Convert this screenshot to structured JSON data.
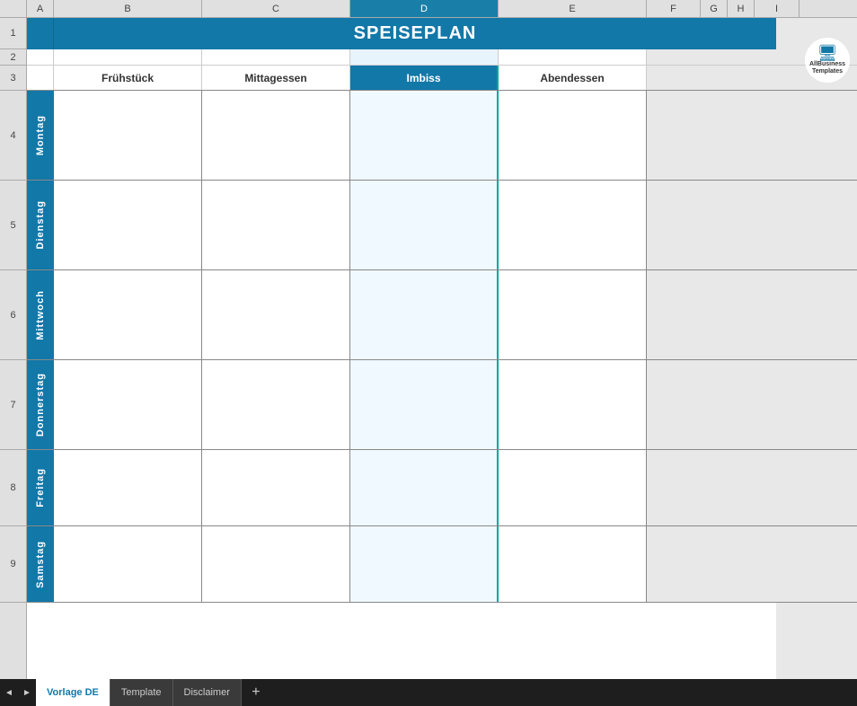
{
  "title": "SPEISEPLAN",
  "columns": {
    "a": "A",
    "b": "B",
    "c": "C",
    "d": "D",
    "e": "E",
    "f": "F",
    "g": "G",
    "h": "H",
    "i": "I"
  },
  "row_numbers": [
    "1",
    "2",
    "3",
    "4",
    "5",
    "6",
    "7",
    "8",
    "9"
  ],
  "headers": {
    "col1": "Frühstück",
    "col2": "Mittagessen",
    "col3": "Imbiss",
    "col4": "Abendessen"
  },
  "days": [
    "Montag",
    "Dienstag",
    "Mittwoch",
    "Donnerstag",
    "Freitag",
    "Samstag"
  ],
  "logo": {
    "line1": "AllBusiness",
    "line2": "Templates"
  },
  "tabs": [
    {
      "label": "Vorlage DE",
      "active": true
    },
    {
      "label": "Template",
      "active": false
    },
    {
      "label": "Disclaimer",
      "active": false
    }
  ],
  "scroll_prev": "◄",
  "scroll_next": "►",
  "add_tab": "+"
}
